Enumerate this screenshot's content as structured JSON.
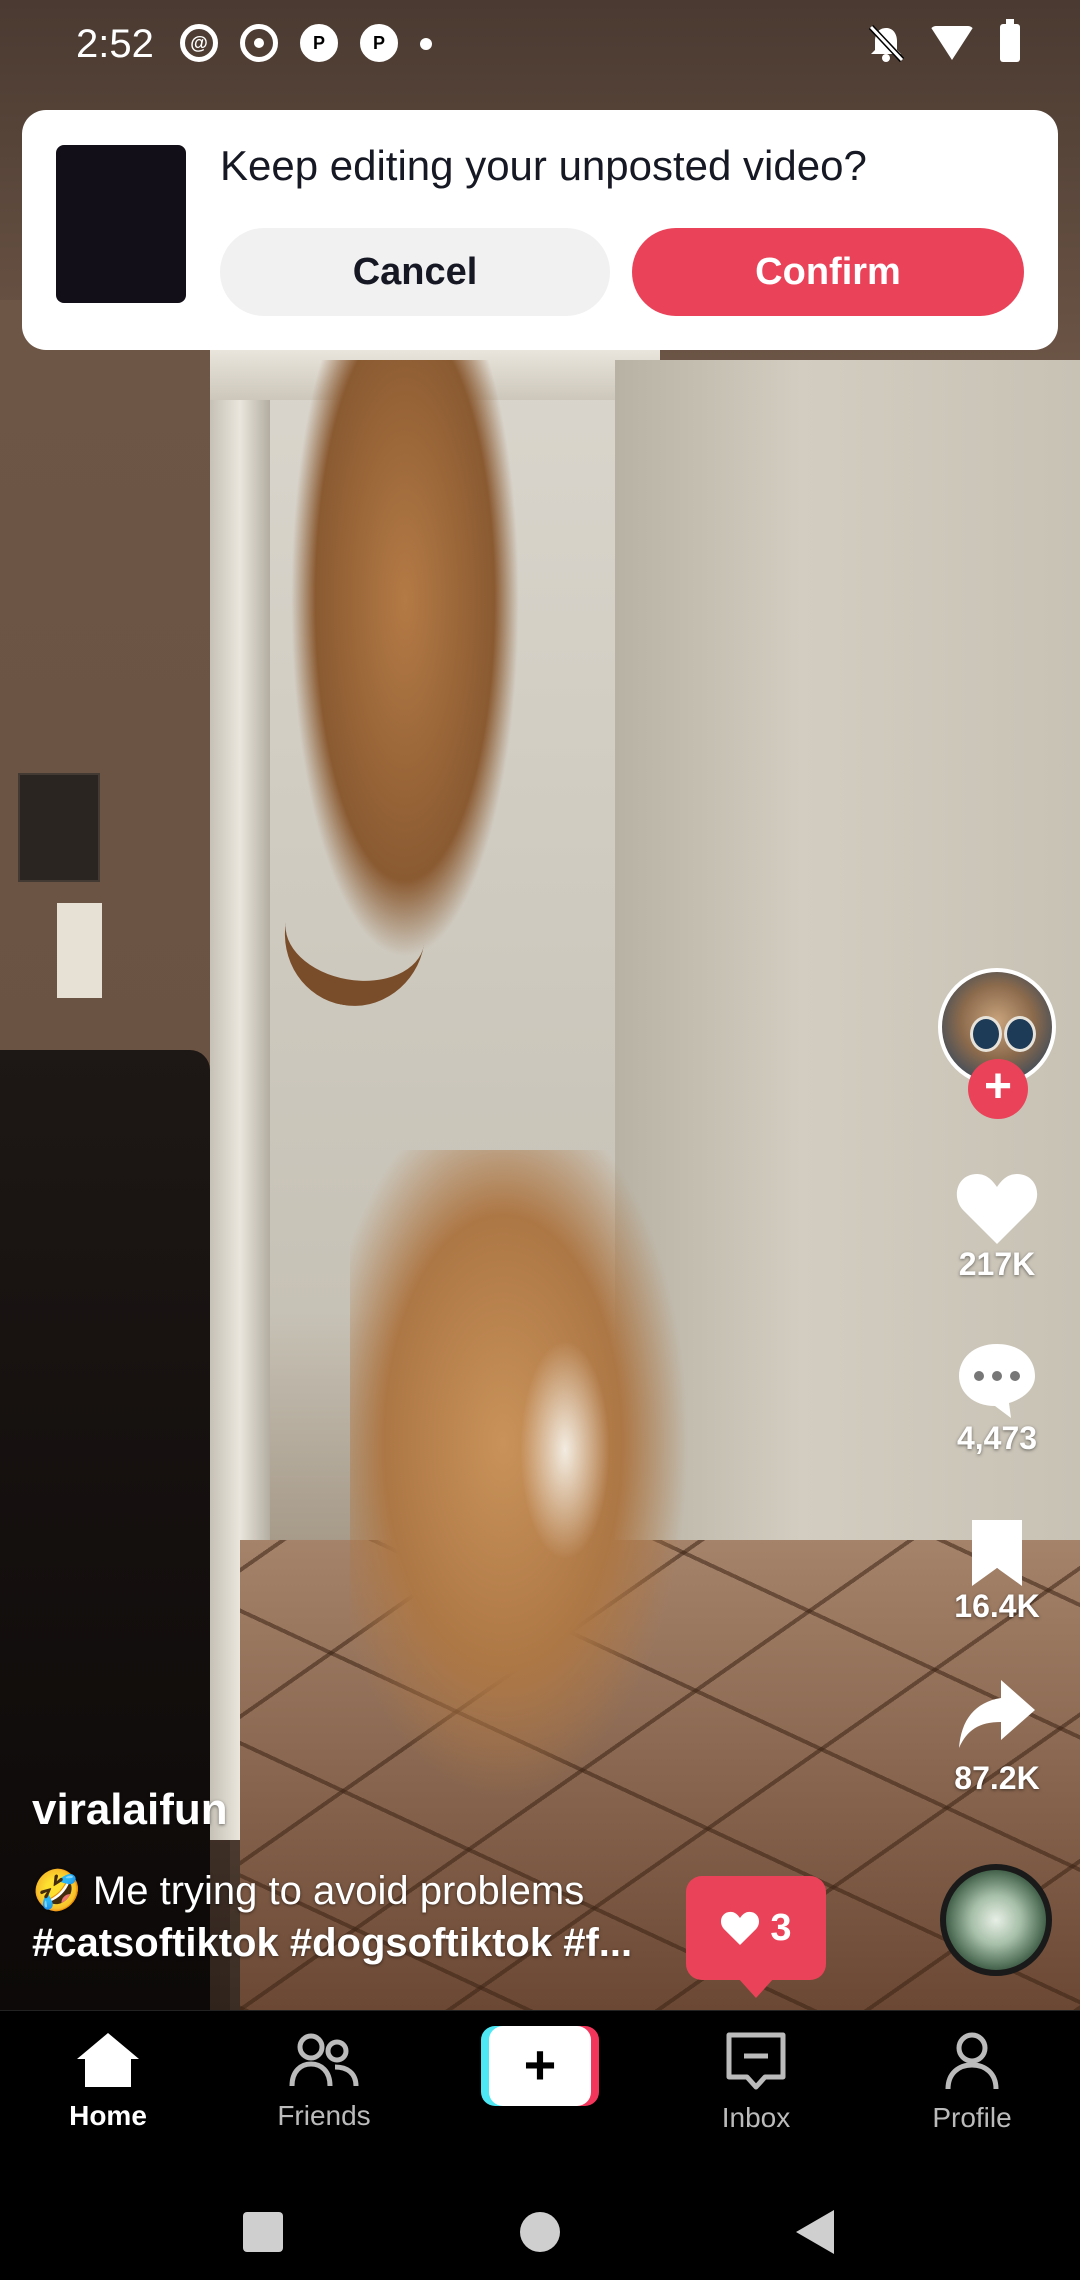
{
  "status_bar": {
    "time": "2:52",
    "icons": [
      "threads-icon",
      "record-icon",
      "pinterest-icon",
      "pinterest-icon",
      "dot-icon"
    ],
    "right_icons": [
      "bell-off-icon",
      "wifi-icon",
      "battery-charging-icon"
    ]
  },
  "draft_dialog": {
    "title": "Keep editing your unposted video?",
    "cancel_label": "Cancel",
    "confirm_label": "Confirm"
  },
  "actions": {
    "likes": "217K",
    "comments": "4,473",
    "bookmarks": "16.4K",
    "shares": "87.2K"
  },
  "post": {
    "username": "viralaifun",
    "caption_line1": "🤣 Me trying to avoid problems",
    "caption_line2": "#catsoftiktok #dogsoftiktok #f..."
  },
  "like_notification": {
    "count": "3"
  },
  "bottom_nav": {
    "home": "Home",
    "friends": "Friends",
    "create": "+",
    "inbox": "Inbox",
    "profile": "Profile"
  },
  "colors": {
    "accent": "#ea4359",
    "cyan": "#4de8f4",
    "pink": "#f2355b"
  }
}
